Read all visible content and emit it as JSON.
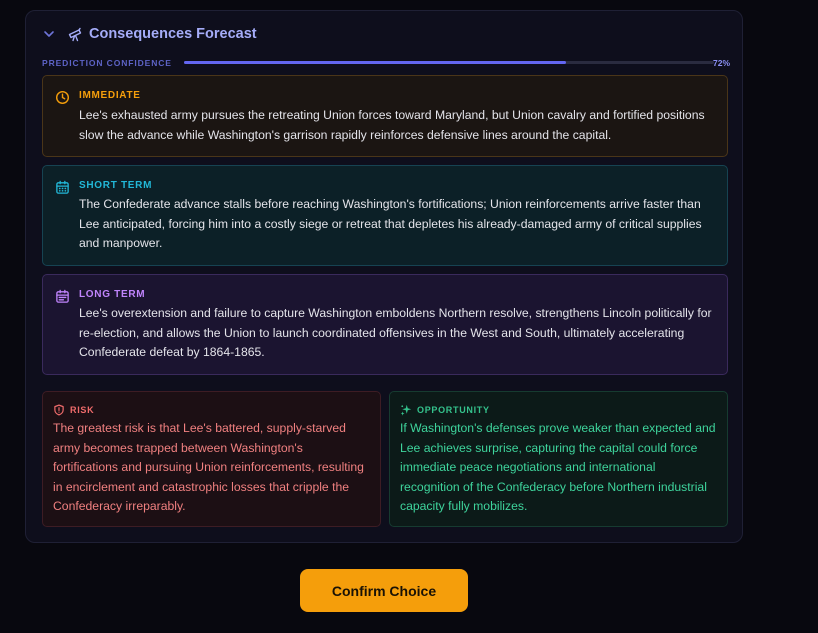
{
  "forecast": {
    "title": "Consequences Forecast",
    "confidence_label": "PREDICTION CONFIDENCE",
    "confidence_value": "72%",
    "confidence_fraction": 0.72,
    "immediate": {
      "label": "IMMEDIATE",
      "icon": "clock-icon",
      "text": "Lee's exhausted army pursues the retreating Union forces toward Maryland, but Union cavalry and fortified positions slow the advance while Washington's garrison rapidly reinforces defensive lines around the capital."
    },
    "short_term": {
      "label": "SHORT TERM",
      "icon": "calendar-icon",
      "text": "The Confederate advance stalls before reaching Washington's fortifications; Union reinforcements arrive faster than Lee anticipated, forcing him into a costly siege or retreat that depletes his already-damaged army of critical supplies and manpower."
    },
    "long_term": {
      "label": "LONG TERM",
      "icon": "calendar-range-icon",
      "text": "Lee's overextension and failure to capture Washington emboldens Northern resolve, strengthens Lincoln politically for re-election, and allows the Union to launch coordinated offensives in the West and South, ultimately accelerating Confederate defeat by 1864-1865."
    },
    "risk": {
      "label": "RISK",
      "icon": "shield-alert-icon",
      "text": "The greatest risk is that Lee's battered, supply-starved army becomes trapped between Washington's fortifications and pursuing Union reinforcements, resulting in encirclement and catastrophic losses that cripple the Confederacy irreparably."
    },
    "opportunity": {
      "label": "OPPORTUNITY",
      "icon": "sparkles-icon",
      "text": "If Washington's defenses prove weaker than expected and Lee achieves surprise, capturing the capital could force immediate peace negotiations and international recognition of the Confederacy before Northern industrial capacity fully mobilizes."
    }
  },
  "actions": {
    "confirm_label": "Confirm Choice"
  },
  "colors": {
    "accent": "#6366f1",
    "immediate": "#f59e0b",
    "short_term": "#22b8d8",
    "long_term": "#c084fc",
    "risk": "#ef6b6b",
    "opportunity": "#34c28c",
    "confirm_button": "#f59e0b"
  }
}
